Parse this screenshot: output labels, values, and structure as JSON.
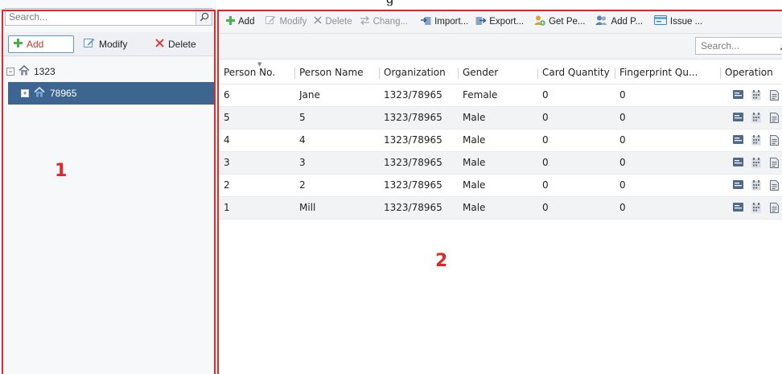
{
  "left": {
    "search": {
      "placeholder": "Search..."
    },
    "toolbar": {
      "add_label": "Add",
      "modify_label": "Modify",
      "delete_label": "Delete"
    },
    "tree": {
      "root": {
        "label": "1323",
        "expander": "−"
      },
      "child": {
        "label": "78965",
        "expander": "+"
      }
    }
  },
  "right": {
    "toolbar": [
      {
        "label": "Add",
        "icon": "plus-icon",
        "enabled": true
      },
      {
        "label": "Modify",
        "icon": "edit-icon",
        "enabled": false
      },
      {
        "label": "Delete",
        "icon": "x-icon",
        "enabled": false
      },
      {
        "label": "Chang...",
        "icon": "change-icon",
        "enabled": false
      },
      {
        "label": "Import...",
        "icon": "import-icon",
        "enabled": true
      },
      {
        "label": "Export...",
        "icon": "export-icon",
        "enabled": true
      },
      {
        "label": "Get Pe...",
        "icon": "get-person-icon",
        "enabled": true
      },
      {
        "label": "Add P...",
        "icon": "add-person-icon",
        "enabled": true
      },
      {
        "label": "Issue ...",
        "icon": "issue-card-icon",
        "enabled": true
      }
    ],
    "search": {
      "placeholder": "Search..."
    },
    "table": {
      "columns": [
        "Person No.",
        "Person Name",
        "Organization",
        "Gender",
        "Card Quantity",
        "Fingerprint Qu...",
        "Operation"
      ],
      "rows": [
        {
          "no": "6",
          "name": "Jane",
          "org": "1323/78965",
          "gender": "Female",
          "cards": "0",
          "fingerprints": "0"
        },
        {
          "no": "5",
          "name": "5",
          "org": "1323/78965",
          "gender": "Male",
          "cards": "0",
          "fingerprints": "0"
        },
        {
          "no": "4",
          "name": "4",
          "org": "1323/78965",
          "gender": "Male",
          "cards": "0",
          "fingerprints": "0"
        },
        {
          "no": "3",
          "name": "3",
          "org": "1323/78965",
          "gender": "Male",
          "cards": "0",
          "fingerprints": "0"
        },
        {
          "no": "2",
          "name": "2",
          "org": "1323/78965",
          "gender": "Male",
          "cards": "0",
          "fingerprints": "0"
        },
        {
          "no": "1",
          "name": "Mill",
          "org": "1323/78965",
          "gender": "Male",
          "cards": "0",
          "fingerprints": "0"
        }
      ]
    }
  },
  "annotations": {
    "label_1": "1",
    "label_2": "2"
  },
  "colors": {
    "accent": "#3e6590",
    "annotation": "#e0282b",
    "add_green": "#4caf50",
    "delete_red": "#d32f2f"
  }
}
